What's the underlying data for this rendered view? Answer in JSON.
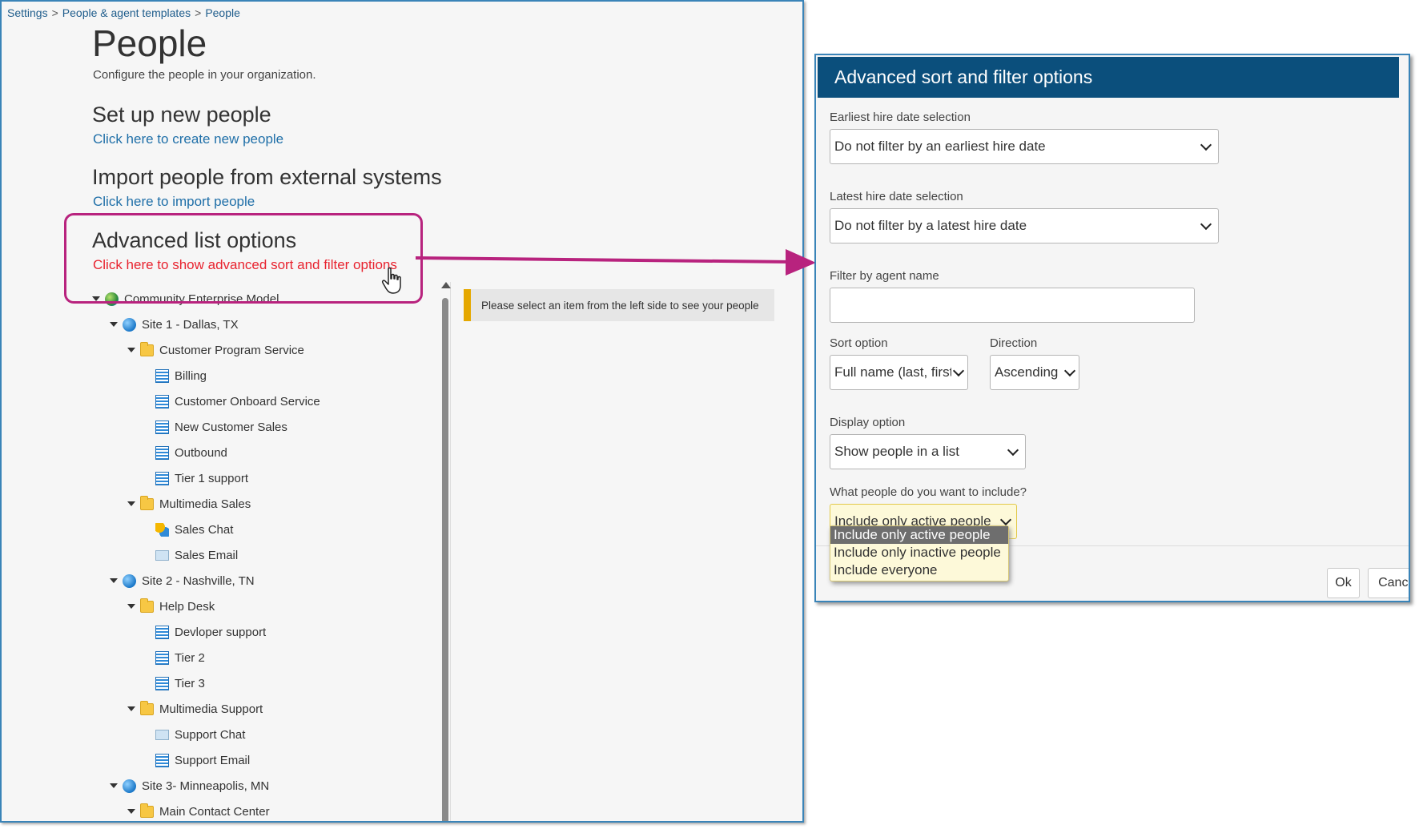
{
  "breadcrumb": {
    "items": [
      "Settings",
      "People & agent templates",
      "People"
    ],
    "separator": ">"
  },
  "page": {
    "title": "People",
    "subtitle": "Configure the people in your organization."
  },
  "sections": {
    "setup": {
      "title": "Set up new people",
      "link": "Click here to create new people"
    },
    "import": {
      "title": "Import people from external systems",
      "link": "Click here to import people"
    },
    "advanced": {
      "title": "Advanced list options",
      "link": "Click here to show advanced sort and filter options"
    }
  },
  "tree": [
    {
      "label": "Community Enterprise Model",
      "icon": "earth-icon",
      "level": 0,
      "expanded": true
    },
    {
      "label": "Site 1 - Dallas, TX",
      "icon": "globe-icon",
      "level": 1,
      "expanded": true
    },
    {
      "label": "Customer Program Service",
      "icon": "folder-icon",
      "level": 2,
      "expanded": true
    },
    {
      "label": "Billing",
      "icon": "queue-icon",
      "level": 3
    },
    {
      "label": "Customer Onboard Service",
      "icon": "queue-icon",
      "level": 3
    },
    {
      "label": "New Customer Sales",
      "icon": "queue-icon",
      "level": 3
    },
    {
      "label": "Outbound",
      "icon": "queue-icon",
      "level": 3
    },
    {
      "label": "Tier 1 support",
      "icon": "queue-icon",
      "level": 3
    },
    {
      "label": "Multimedia Sales",
      "icon": "folder-icon",
      "level": 2,
      "expanded": true
    },
    {
      "label": "Sales Chat",
      "icon": "chat-icon",
      "level": 3
    },
    {
      "label": "Sales Email",
      "icon": "email-icon",
      "level": 3
    },
    {
      "label": "Site 2 - Nashville, TN",
      "icon": "globe-icon",
      "level": 1,
      "expanded": true
    },
    {
      "label": "Help Desk",
      "icon": "folder-icon",
      "level": 2,
      "expanded": true
    },
    {
      "label": "Devloper support",
      "icon": "queue-icon",
      "level": 3
    },
    {
      "label": "Tier 2",
      "icon": "queue-icon",
      "level": 3
    },
    {
      "label": "Tier 3",
      "icon": "queue-icon",
      "level": 3
    },
    {
      "label": "Multimedia Support",
      "icon": "folder-icon",
      "level": 2,
      "expanded": true
    },
    {
      "label": "Support Chat",
      "icon": "email-icon",
      "level": 3
    },
    {
      "label": "Support Email",
      "icon": "queue-icon",
      "level": 3
    },
    {
      "label": "Site 3- Minneapolis, MN",
      "icon": "globe-icon",
      "level": 1,
      "expanded": true
    },
    {
      "label": "Main Contact Center",
      "icon": "folder-icon",
      "level": 2,
      "expanded": true
    }
  ],
  "info_message": "Please select an item from the left side to see your people",
  "dialog": {
    "title": "Advanced sort and filter options",
    "earliest_label": "Earliest hire date selection",
    "earliest_value": "Do not filter by an earliest hire date",
    "latest_label": "Latest hire date selection",
    "latest_value": "Do not filter by a latest hire date",
    "agent_name_label": "Filter by agent name",
    "agent_name_value": "",
    "sort_label": "Sort option",
    "sort_value": "Full name (last, first)",
    "direction_label": "Direction",
    "direction_value": "Ascending",
    "display_label": "Display option",
    "display_value": "Show people in a list",
    "include_label": "What people do you want to include?",
    "include_value": "Include only active people",
    "include_options": [
      "Include only active people",
      "Include only inactive people",
      "Include everyone"
    ],
    "ok_label": "Ok",
    "cancel_label": "Cancel"
  },
  "colors": {
    "header": "#0b4f7c",
    "link": "#1f6fa8",
    "highlight": "#b8237e",
    "advanced_link": "#e8232f",
    "info_accent": "#e5a800"
  }
}
